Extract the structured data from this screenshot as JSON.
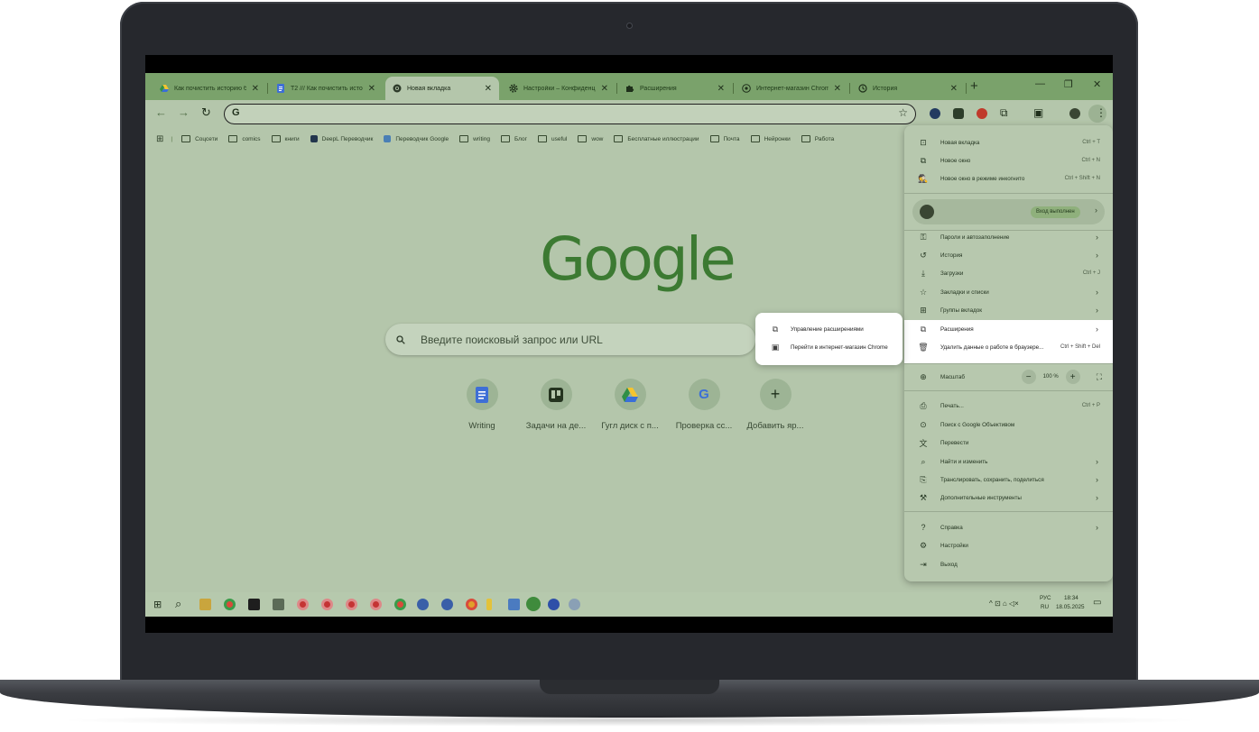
{
  "tabs": [
    {
      "title": "Как почистить историю б",
      "icon": "google-drive-icon"
    },
    {
      "title": "T2 /// Как почистить исто",
      "icon": "google-docs-icon"
    },
    {
      "title": "Новая вкладка",
      "icon": "chrome-icon",
      "active": true
    },
    {
      "title": "Настройки – Конфиденц",
      "icon": "gear-icon"
    },
    {
      "title": "Расширения",
      "icon": "puzzle-icon"
    },
    {
      "title": "Интернет-магазин Chrom",
      "icon": "chrome-web-store-icon"
    },
    {
      "title": "История",
      "icon": "history-icon"
    }
  ],
  "bookmarks": [
    {
      "label": "Соцсети",
      "type": "folder"
    },
    {
      "label": "comics",
      "type": "folder"
    },
    {
      "label": "книги",
      "type": "folder"
    },
    {
      "label": "DeepL Переводчик",
      "type": "site",
      "color": "#23364d"
    },
    {
      "label": "Переводчик Google",
      "type": "site",
      "color": "#4a7fb5"
    },
    {
      "label": "writing",
      "type": "folder"
    },
    {
      "label": "Блог",
      "type": "folder"
    },
    {
      "label": "useful",
      "type": "folder"
    },
    {
      "label": "wow",
      "type": "folder"
    },
    {
      "label": "Бесплатные иллюстрации",
      "type": "folder"
    },
    {
      "label": "Почта",
      "type": "folder"
    },
    {
      "label": "Нейронки",
      "type": "folder"
    },
    {
      "label": "Работа",
      "type": "folder"
    }
  ],
  "google": {
    "logo": "Google",
    "search_placeholder": "Введите поисковый запрос или URL"
  },
  "shortcuts": [
    {
      "label": "Writing",
      "icon": "google-docs-icon"
    },
    {
      "label": "Задачи на де...",
      "icon": "trello-icon"
    },
    {
      "label": "Гугл диск с п...",
      "icon": "google-drive-icon"
    },
    {
      "label": "Проверка сс...",
      "icon": "google-icon"
    },
    {
      "label": "Добавить яр...",
      "icon": "plus-icon"
    }
  ],
  "menu": {
    "new_tab": {
      "label": "Новая вкладка",
      "shortcut": "Ctrl + T"
    },
    "new_window": {
      "label": "Новое окно",
      "shortcut": "Ctrl + N"
    },
    "incognito": {
      "label": "Новое окно в режиме инкогнито",
      "shortcut": "Ctrl + Shift + N"
    },
    "profile_status": "Вход выполнен",
    "passwords": "Пароли и автозаполнение",
    "history": "История",
    "downloads": {
      "label": "Загрузки",
      "shortcut": "Ctrl + J"
    },
    "bookmarks": "Закладки и списки",
    "tab_groups": "Группы вкладок",
    "extensions": "Расширения",
    "clear_data": {
      "label": "Удалить данные о работе в браузере...",
      "shortcut": "Ctrl + Shift + Del"
    },
    "zoom": {
      "label": "Масштаб",
      "value": "100 %",
      "minus": "−",
      "plus": "+"
    },
    "print": {
      "label": "Печать...",
      "shortcut": "Ctrl + P"
    },
    "google_lens": "Поиск с Google Объективом",
    "translate": "Перевести",
    "find_edit": "Найти и изменить",
    "cast_save_share": "Транслировать, сохранить, поделиться",
    "more_tools": "Дополнительные инструменты",
    "help": "Справка",
    "settings": "Настройки",
    "exit": "Выход"
  },
  "submenu": {
    "manage_extensions": "Управление расширениями",
    "web_store": "Перейти в интернет-магазин Chrome"
  },
  "taskbar": {
    "language_top": "РУС",
    "language_bottom": "RU",
    "time": "18:34",
    "date": "18.05.2025"
  },
  "colors": {
    "tab_strip": "#7aa26b",
    "page_bg": "#b4c6ab",
    "highlight": "#ffffff",
    "google_logo": "#3c7a32"
  }
}
